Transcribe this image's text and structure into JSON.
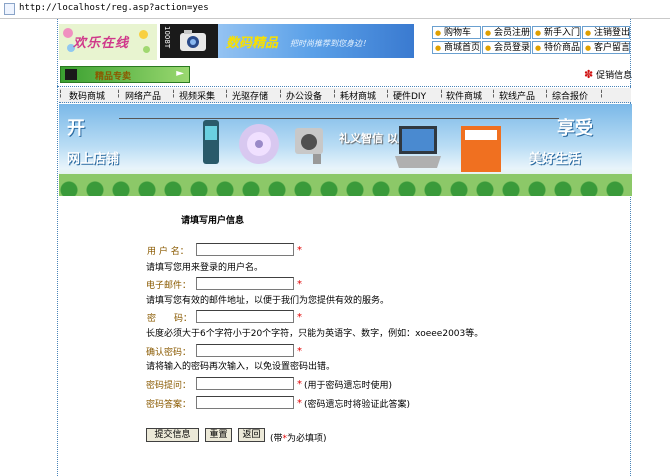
{
  "browser": {
    "url": "http://localhost/reg.asp?action=yes"
  },
  "logo": {
    "text": "欢乐在线"
  },
  "banner": {
    "side_text": "1008T",
    "title": "数码精品",
    "tagline": "把时尚推荐到您身边！"
  },
  "top_nav": [
    "购物车",
    "会员注册",
    "新手入门",
    "注销登出",
    "商城首页",
    "会员登录",
    "特价商品",
    "客户留言"
  ],
  "sell_button": "精品专卖",
  "promo_link": "促销信息",
  "menu": [
    "数码商城",
    "网络产品",
    "视频采集",
    "光驱存储",
    "办公设备",
    "耗材商城",
    "硬件DIY",
    "软件商城",
    "软线产品",
    "综合报价"
  ],
  "hero": {
    "left_big": "开",
    "left_sub": "网上店铺",
    "slogan": "礼义智信 以人为本",
    "right_big": "享受",
    "right_sub": "美好生活"
  },
  "form": {
    "title": "请填写用户信息",
    "fields": [
      {
        "label": "用 户 名：",
        "required": true,
        "hint": "请填写您用来登录的用户名。"
      },
      {
        "label": "电子邮件：",
        "required": true,
        "hint": "请填写您有效的邮件地址，以便于我们为您提供有效的服务。"
      },
      {
        "label": "密　　码：",
        "required": true,
        "hint": "长度必须大于6个字符小于20个字符，只能为英语字、数字，例如：xoeee2003等。"
      },
      {
        "label": "确认密码：",
        "required": true,
        "hint": "请将输入的密码再次输入，以免设置密码出错。"
      },
      {
        "label": "密码提问：",
        "required": true,
        "hint": "(用于密码遗忘时使用)"
      },
      {
        "label": "密码答案：",
        "required": true,
        "hint": "(密码遗忘时将验证此答案)"
      }
    ],
    "buttons": {
      "submit": "提交信息",
      "reset": "重置",
      "back": "返回"
    },
    "note_prefix": "(带",
    "note_star": "*",
    "note_suffix": "为必填项)"
  },
  "colors": {
    "label": "#8a5a00",
    "required_star": "#e00000",
    "frame_border": "#4a84b8"
  }
}
